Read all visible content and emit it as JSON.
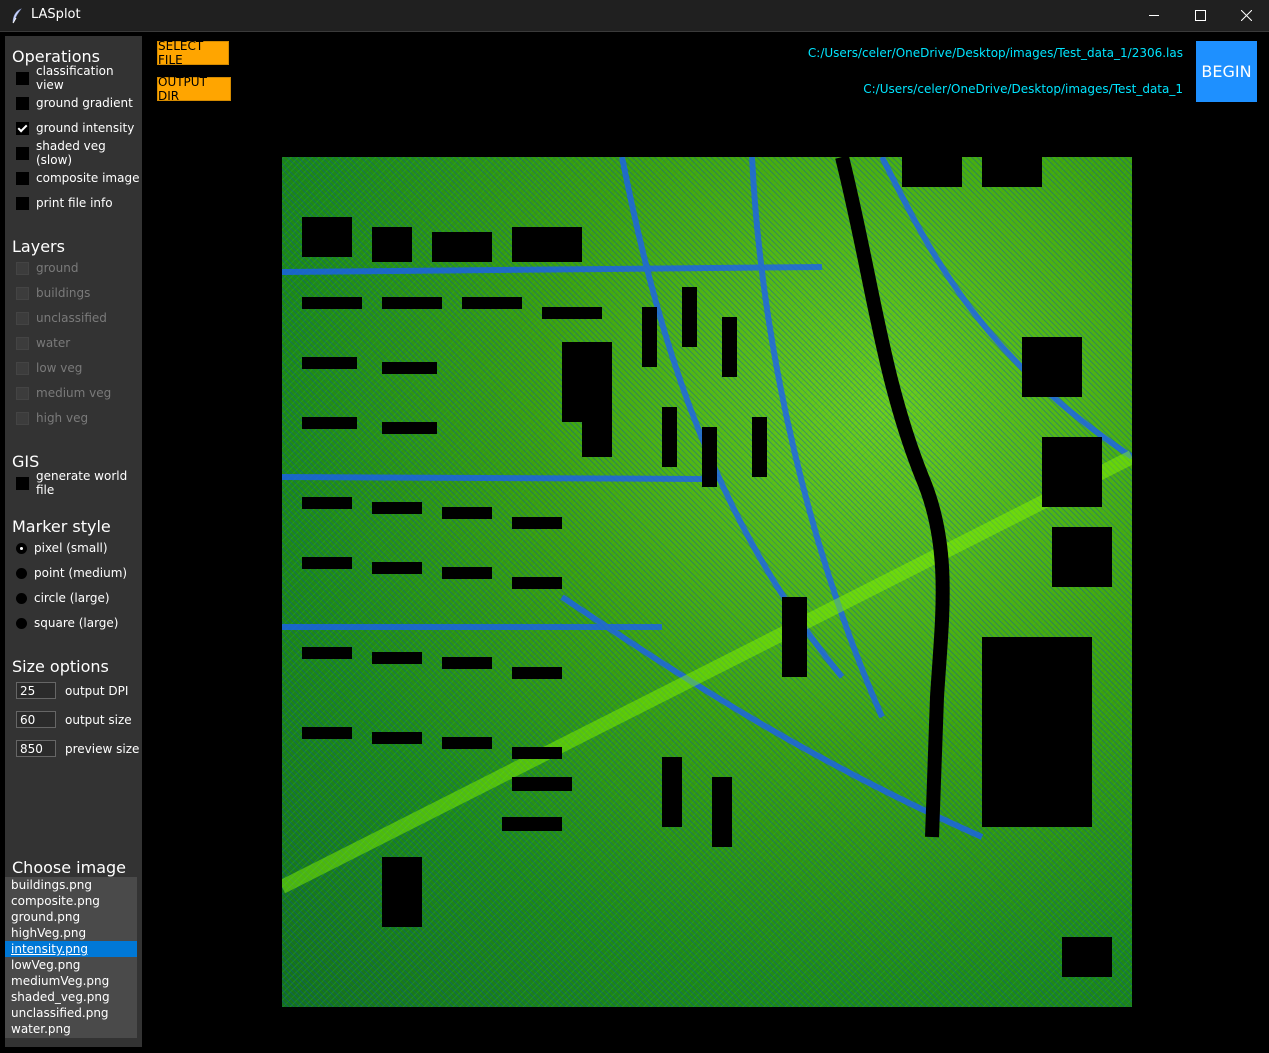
{
  "window": {
    "title": "LASplot",
    "minimize_glyph": "—",
    "maximize_glyph": "☐",
    "close_glyph": "✕"
  },
  "sidebar": {
    "operations": {
      "title": "Operations",
      "items": [
        {
          "label": "classification view",
          "checked": false
        },
        {
          "label": "ground gradient",
          "checked": false
        },
        {
          "label": "ground intensity",
          "checked": true
        },
        {
          "label": "shaded veg (slow)",
          "checked": false
        },
        {
          "label": "composite image",
          "checked": false
        },
        {
          "label": "print file info",
          "checked": false
        }
      ]
    },
    "layers": {
      "title": "Layers",
      "items": [
        {
          "label": "ground"
        },
        {
          "label": "buildings"
        },
        {
          "label": "unclassified"
        },
        {
          "label": "water"
        },
        {
          "label": "low veg"
        },
        {
          "label": "medium veg"
        },
        {
          "label": "high veg"
        }
      ]
    },
    "gis": {
      "title": "GIS",
      "items": [
        {
          "label": "generate world file",
          "checked": false
        }
      ]
    },
    "marker_style": {
      "title": "Marker style",
      "items": [
        {
          "label": "pixel (small)",
          "selected": true
        },
        {
          "label": "point (medium)",
          "selected": false
        },
        {
          "label": "circle (large)",
          "selected": false
        },
        {
          "label": "square (large)",
          "selected": false
        }
      ]
    },
    "size_options": {
      "title": "Size options",
      "items": [
        {
          "value": "25",
          "label": "output DPI"
        },
        {
          "value": "60",
          "label": "output size"
        },
        {
          "value": "850",
          "label": "preview size"
        }
      ]
    },
    "choose_image": {
      "title": "Choose image",
      "items": [
        "buildings.png",
        "composite.png",
        "ground.png",
        "highVeg.png",
        "intensity.png",
        "lowVeg.png",
        "mediumVeg.png",
        "shaded_veg.png",
        "unclassified.png",
        "water.png"
      ],
      "selected": "intensity.png"
    }
  },
  "toolbar": {
    "select_file_label": "SELECT FILE",
    "output_dir_label": "OUTPUT DIR",
    "file_path": "C:/Users/celer/OneDrive/Desktop/images/Test_data_1/2306.las",
    "output_path": "C:/Users/celer/OneDrive/Desktop/images/Test_data_1",
    "begin_label": "BEGIN"
  },
  "colors": {
    "button_orange": "#ffa500",
    "begin_blue": "#1e90ff",
    "path_cyan": "#00e5ff",
    "list_selection": "#0078d7",
    "sidebar_bg": "#333333"
  }
}
